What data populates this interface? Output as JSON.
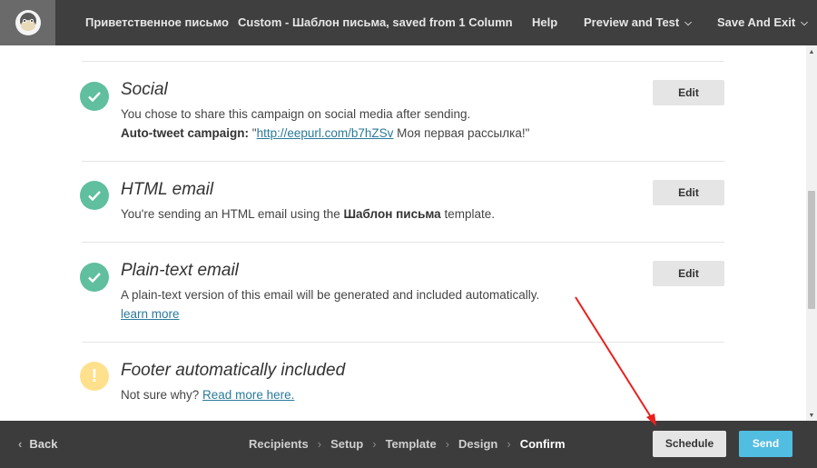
{
  "header": {
    "logo_icon": "mailchimp-monkey-icon",
    "campaign_name": "Приветственное письмо",
    "template_name": "Custom - Шаблон письма, saved from 1 Column",
    "help_label": "Help",
    "preview_label": "Preview and Test",
    "save_exit_label": "Save And Exit"
  },
  "sections": {
    "social": {
      "title": "Social",
      "text": "You chose to share this campaign on social media after sending.",
      "autotweet_label": "Auto-tweet campaign:",
      "autotweet_quote_open": "\"",
      "autotweet_link": "http://eepurl.com/b7hZSv",
      "autotweet_rest": " Моя первая рассылка!\"",
      "edit_label": "Edit"
    },
    "html_email": {
      "title": "HTML email",
      "text_before": "You're sending an HTML email using the ",
      "template_bold": "Шаблон письма",
      "text_after": " template.",
      "edit_label": "Edit"
    },
    "plain_text": {
      "title": "Plain-text email",
      "text": "A plain-text version of this email will be generated and included automatically.",
      "link": "learn more",
      "edit_label": "Edit"
    },
    "footer": {
      "title": "Footer automatically included",
      "text": "Not sure why? ",
      "link": "Read more here.",
      "warn_symbol": "!"
    }
  },
  "bottom": {
    "back_label": "Back",
    "steps": [
      "Recipients",
      "Setup",
      "Template",
      "Design",
      "Confirm"
    ],
    "schedule_label": "Schedule",
    "send_label": "Send"
  },
  "colors": {
    "check": "#5fbf9f",
    "warn": "#ffe08c",
    "send": "#51bde0",
    "annotation_arrow": "#e8201e"
  }
}
